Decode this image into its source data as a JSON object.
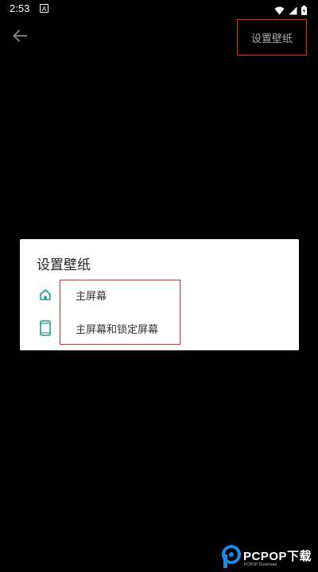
{
  "status_bar": {
    "time": "2:53",
    "icons": [
      "notification-a-icon",
      "wifi-icon",
      "signal-icon",
      "battery-icon"
    ]
  },
  "toolbar": {
    "back_icon": "arrow-back-icon",
    "action_label": "设置壁纸"
  },
  "dialog": {
    "title": "设置壁纸",
    "options": [
      {
        "icon": "home-icon",
        "label": "主屏幕"
      },
      {
        "icon": "phone-icon",
        "label": "主屏幕和锁定屏幕"
      }
    ]
  },
  "watermark": {
    "text": "PCPOP下载",
    "sub": "PCPOP Download"
  },
  "colors": {
    "background": "#000000",
    "icon_accent": "#1f9a8f",
    "highlight": "#e32b2b",
    "dialog_bg": "#ffffff"
  }
}
